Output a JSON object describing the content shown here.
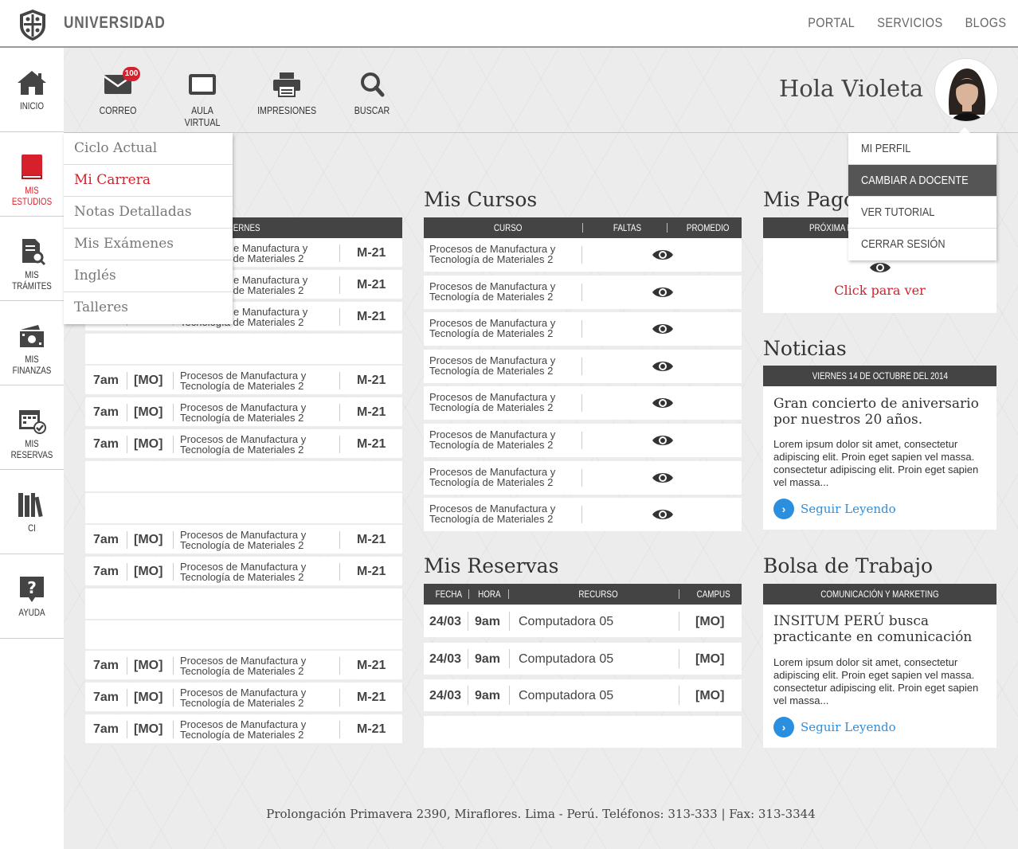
{
  "brand": "UNIVERSIDAD",
  "topnav": [
    "PORTAL",
    "SERVICIOS",
    "BLOGS"
  ],
  "sidebar": {
    "items": [
      {
        "label": "INICIO",
        "icon": "home-icon"
      },
      {
        "label": "MIS ESTUDIOS",
        "icon": "book-icon"
      },
      {
        "label": "MIS TRÁMITES",
        "icon": "document-search-icon"
      },
      {
        "label": "MIS FINANZAS",
        "icon": "money-icon"
      },
      {
        "label": "MIS RESERVAS",
        "icon": "calendar-check-icon"
      },
      {
        "label": "CI",
        "icon": "library-icon"
      },
      {
        "label": "AYUDA",
        "icon": "help-icon"
      }
    ]
  },
  "toolbar": {
    "items": [
      {
        "label": "CORREO",
        "icon": "mail-icon"
      },
      {
        "label": "AULA VIRTUAL",
        "icon": "tablet-icon"
      },
      {
        "label": "IMPRESIONES",
        "icon": "printer-icon"
      },
      {
        "label": "BUSCAR",
        "icon": "search-icon"
      }
    ],
    "mail_badge": "100"
  },
  "greeting": "Hola Violeta",
  "studies_menu": [
    "Ciclo Actual",
    "Mi Carrera",
    "Notas Detalladas",
    "Mis Exámenes",
    "Inglés",
    "Talleres"
  ],
  "profile_menu": [
    "MI PERFIL",
    "CAMBIAR A DOCENTE",
    "VER TUTORIAL",
    "CERRAR SESIÓN"
  ],
  "schedule": {
    "visible_header": "ERNES",
    "partial_course": "e Manufactura y",
    "row": {
      "time": "7am",
      "campus": "[MO]",
      "course_l1": "Procesos de Manufactura y",
      "course_l2": "Tecnología de Materiales 2",
      "room": "M-21"
    }
  },
  "cursos": {
    "title": "Mis Cursos",
    "headers": [
      "CURSO",
      "FALTAS",
      "PROMEDIO"
    ],
    "course_l1": "Procesos de Manufactura y",
    "course_l2": "Tecnología de Materiales 2"
  },
  "reservas": {
    "title": "Mis Reservas",
    "headers": [
      "FECHA",
      "HORA",
      "RECURSO",
      "CAMPUS"
    ],
    "row": {
      "fecha": "24/03",
      "hora": "9am",
      "recurso": "Computadora 05",
      "campus": "[MO]"
    }
  },
  "pagos": {
    "title": "Mis Pagos",
    "header": "PRÓXIMA B",
    "link": "Click para ver"
  },
  "noticias": {
    "title": "Noticias",
    "date_header": "VIERNES 14 DE OCTUBRE DEL 2014",
    "headline": "Gran concierto de aniversario por nuestros 20 años.",
    "body": "Lorem ipsum dolor sit amet, consectetur adipiscing elit. Proin eget sapien vel massa. consectetur adipiscing elit. Proin eget sapien vel massa...",
    "more": "Seguir Leyendo"
  },
  "bolsa": {
    "title": "Bolsa de Trabajo",
    "header": "COMUNICACIÓN Y MARKETING",
    "headline": "INSITUM PERÚ busca practicante en comunicación",
    "body": "Lorem ipsum dolor sit amet, consectetur adipiscing elit. Proin eget sapien vel massa. consectetur adipiscing elit. Proin eget sapien vel massa...",
    "more": "Seguir Leyendo"
  },
  "footer": "Prolongación Primavera 2390, Miraflores. Lima - Perú. Teléfonos: 313-333 | Fax: 313-3344",
  "colors": {
    "accent": "#d6202b",
    "link": "#2b8fe0",
    "header_dark": "#444444"
  }
}
